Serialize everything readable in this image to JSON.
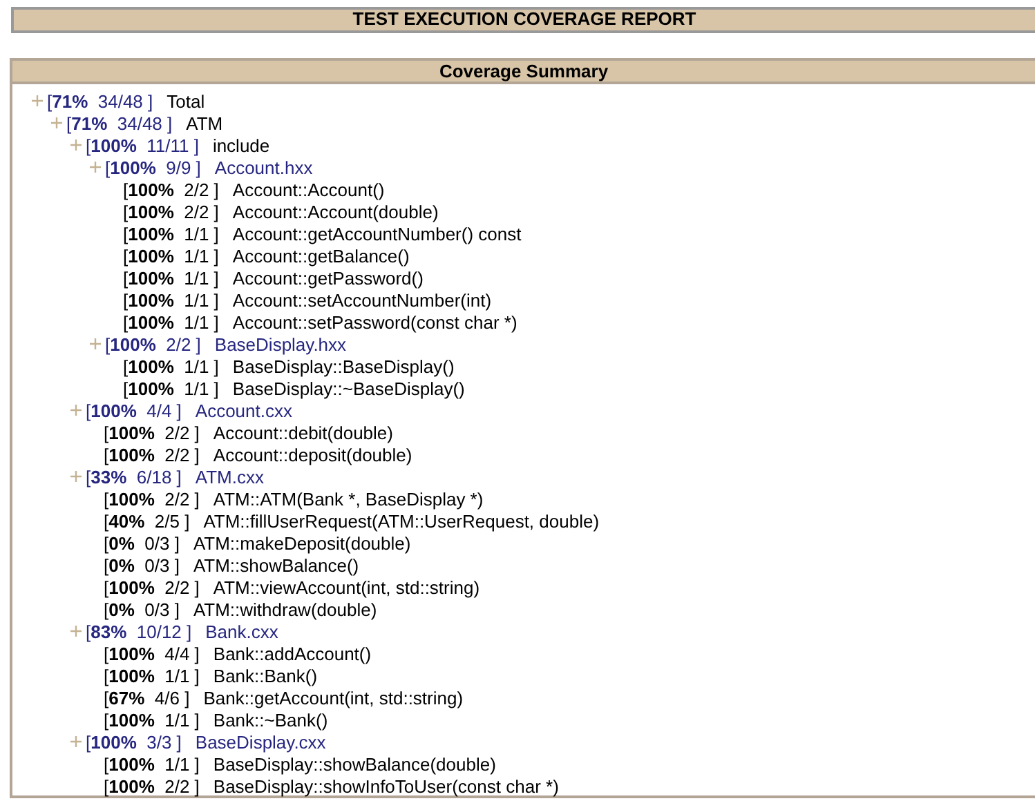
{
  "report_title": "TEST EXECUTION COVERAGE REPORT",
  "summary": {
    "title": "Coverage Summary",
    "tree": [
      {
        "kind": "folder",
        "stat": "[**71%**  34/48 ]",
        "name": "Total",
        "children": [
          {
            "kind": "folder",
            "stat": "[**71%**  34/48 ]",
            "name": "ATM",
            "children": [
              {
                "kind": "folder",
                "stat": "[**100%**  11/11 ]",
                "name": "include",
                "children": [
                  {
                    "kind": "file",
                    "stat": "[**100%**  9/9 ]",
                    "name": "Account.hxx",
                    "children": [
                      {
                        "kind": "function",
                        "stat": "[**100%**  2/2 ]",
                        "name": "Account::Account()"
                      },
                      {
                        "kind": "function",
                        "stat": "[**100%**  2/2 ]",
                        "name": "Account::Account(double)"
                      },
                      {
                        "kind": "function",
                        "stat": "[**100%**  1/1 ]",
                        "name": "Account::getAccountNumber() const"
                      },
                      {
                        "kind": "function",
                        "stat": "[**100%**  1/1 ]",
                        "name": "Account::getBalance()"
                      },
                      {
                        "kind": "function",
                        "stat": "[**100%**  1/1 ]",
                        "name": "Account::getPassword()"
                      },
                      {
                        "kind": "function",
                        "stat": "[**100%**  1/1 ]",
                        "name": "Account::setAccountNumber(int)"
                      },
                      {
                        "kind": "function",
                        "stat": "[**100%**  1/1 ]",
                        "name": "Account::setPassword(const char *)"
                      }
                    ]
                  },
                  {
                    "kind": "file",
                    "stat": "[**100%**  2/2 ]",
                    "name": "BaseDisplay.hxx",
                    "children": [
                      {
                        "kind": "function",
                        "stat": "[**100%**  1/1 ]",
                        "name": "BaseDisplay::BaseDisplay()"
                      },
                      {
                        "kind": "function",
                        "stat": "[**100%**  1/1 ]",
                        "name": "BaseDisplay::~BaseDisplay()"
                      }
                    ]
                  }
                ]
              },
              {
                "kind": "file",
                "stat": "[**100%**  4/4 ]",
                "name": "Account.cxx",
                "children": [
                  {
                    "kind": "function",
                    "stat": "[**100%**  2/2 ]",
                    "name": "Account::debit(double)"
                  },
                  {
                    "kind": "function",
                    "stat": "[**100%**  2/2 ]",
                    "name": "Account::deposit(double)"
                  }
                ]
              },
              {
                "kind": "file",
                "stat": "[**33%**  6/18 ]",
                "name": "ATM.cxx",
                "children": [
                  {
                    "kind": "function",
                    "stat": "[**100%**  2/2 ]",
                    "name": "ATM::ATM(Bank *, BaseDisplay *)"
                  },
                  {
                    "kind": "function",
                    "stat": "[**40%**  2/5 ]",
                    "name": "ATM::fillUserRequest(ATM::UserRequest, double)"
                  },
                  {
                    "kind": "function",
                    "stat": "[**0%**  0/3 ]",
                    "name": "ATM::makeDeposit(double)"
                  },
                  {
                    "kind": "function",
                    "stat": "[**0%**  0/3 ]",
                    "name": "ATM::showBalance()"
                  },
                  {
                    "kind": "function",
                    "stat": "[**100%**  2/2 ]",
                    "name": "ATM::viewAccount(int, std::string)"
                  },
                  {
                    "kind": "function",
                    "stat": "[**0%**  0/3 ]",
                    "name": "ATM::withdraw(double)"
                  }
                ]
              },
              {
                "kind": "file",
                "stat": "[**83%**  10/12 ]",
                "name": "Bank.cxx",
                "children": [
                  {
                    "kind": "function",
                    "stat": "[**100%**  4/4 ]",
                    "name": "Bank::addAccount()"
                  },
                  {
                    "kind": "function",
                    "stat": "[**100%**  1/1 ]",
                    "name": "Bank::Bank()"
                  },
                  {
                    "kind": "function",
                    "stat": "[**67%**  4/6 ]",
                    "name": "Bank::getAccount(int, std::string)"
                  },
                  {
                    "kind": "function",
                    "stat": "[**100%**  1/1 ]",
                    "name": "Bank::~Bank()"
                  }
                ]
              },
              {
                "kind": "file",
                "stat": "[**100%**  3/3 ]",
                "name": "BaseDisplay.cxx",
                "children": [
                  {
                    "kind": "function",
                    "stat": "[**100%**  1/1 ]",
                    "name": "BaseDisplay::showBalance(double)"
                  },
                  {
                    "kind": "function",
                    "stat": "[**100%**  2/2 ]",
                    "name": "BaseDisplay::showInfoToUser(const char *)"
                  }
                ]
              }
            ]
          }
        ]
      }
    ]
  }
}
